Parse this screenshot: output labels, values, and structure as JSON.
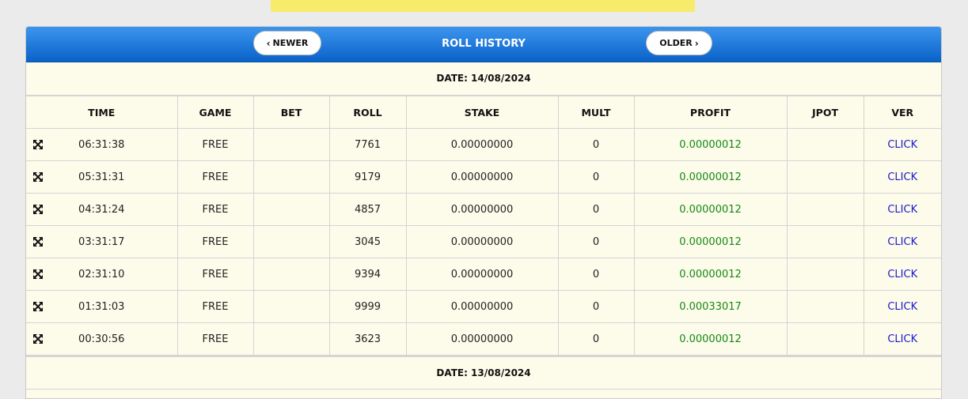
{
  "header": {
    "title": "ROLL HISTORY",
    "newer_label": "NEWER",
    "older_label": "OLDER"
  },
  "columns": [
    "TIME",
    "GAME",
    "BET",
    "ROLL",
    "STAKE",
    "MULT",
    "PROFIT",
    "JPOT",
    "VER"
  ],
  "groups": [
    {
      "date": "DATE: 14/08/2024",
      "rows": [
        {
          "time": "06:31:38",
          "game": "FREE",
          "bet": "",
          "roll": "7761",
          "stake": "0.00000000",
          "mult": "0",
          "profit": "0.00000012",
          "jpot": "",
          "ver": "CLICK"
        },
        {
          "time": "05:31:31",
          "game": "FREE",
          "bet": "",
          "roll": "9179",
          "stake": "0.00000000",
          "mult": "0",
          "profit": "0.00000012",
          "jpot": "",
          "ver": "CLICK"
        },
        {
          "time": "04:31:24",
          "game": "FREE",
          "bet": "",
          "roll": "4857",
          "stake": "0.00000000",
          "mult": "0",
          "profit": "0.00000012",
          "jpot": "",
          "ver": "CLICK"
        },
        {
          "time": "03:31:17",
          "game": "FREE",
          "bet": "",
          "roll": "3045",
          "stake": "0.00000000",
          "mult": "0",
          "profit": "0.00000012",
          "jpot": "",
          "ver": "CLICK"
        },
        {
          "time": "02:31:10",
          "game": "FREE",
          "bet": "",
          "roll": "9394",
          "stake": "0.00000000",
          "mult": "0",
          "profit": "0.00000012",
          "jpot": "",
          "ver": "CLICK"
        },
        {
          "time": "01:31:03",
          "game": "FREE",
          "bet": "",
          "roll": "9999",
          "stake": "0.00000000",
          "mult": "0",
          "profit": "0.00033017",
          "jpot": "",
          "ver": "CLICK"
        },
        {
          "time": "00:30:56",
          "game": "FREE",
          "bet": "",
          "roll": "3623",
          "stake": "0.00000000",
          "mult": "0",
          "profit": "0.00000012",
          "jpot": "",
          "ver": "CLICK"
        }
      ]
    },
    {
      "date": "DATE: 13/08/2024",
      "rows": []
    }
  ],
  "colors": {
    "header_top": "#3b95ee",
    "header_bottom": "#0a62c8",
    "profit": "#148a14",
    "link": "#1a1acc",
    "panel_bg": "#fdfbea",
    "banner": "#f7eb6b"
  },
  "icons": {
    "nav_newer": "chevron-left-icon",
    "nav_older": "chevron-right-icon",
    "row_expand": "expand-arrows-icon"
  }
}
